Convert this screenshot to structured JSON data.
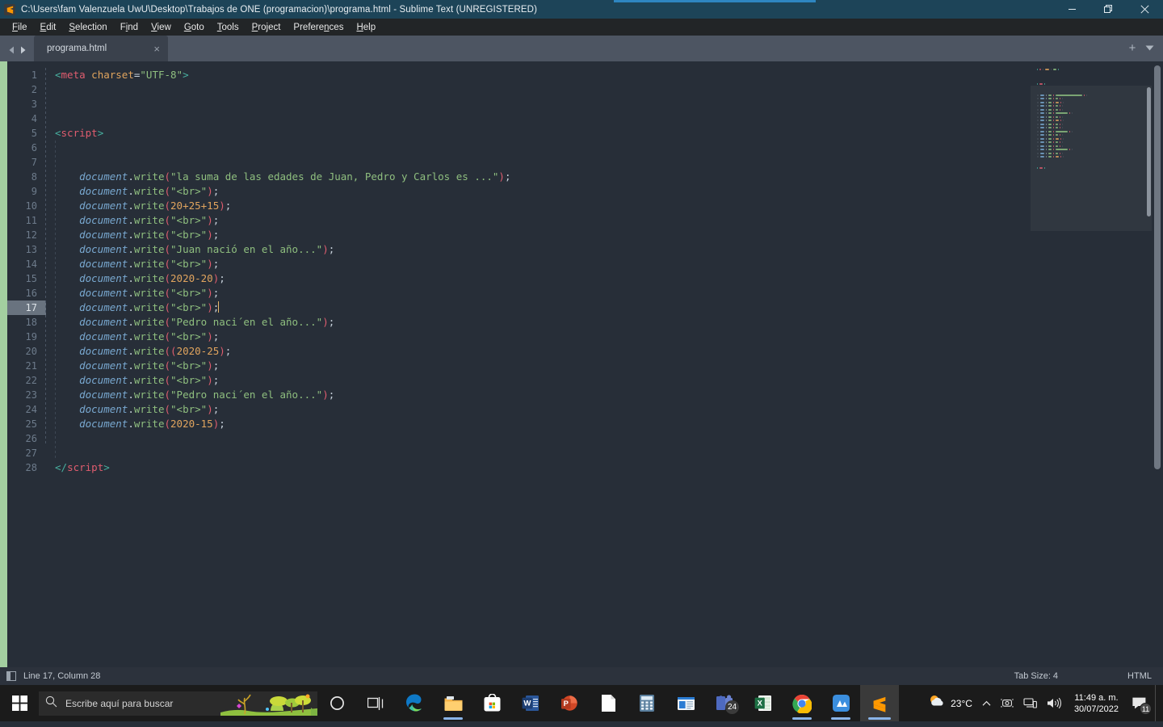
{
  "window": {
    "title": "C:\\Users\\fam Valenzuela UwU\\Desktop\\Trabajos de ONE (programacion)\\programa.html - Sublime Text (UNREGISTERED)",
    "app_icon": "sublime-text-icon",
    "controls": {
      "minimize": "minimize-icon",
      "maximize": "restore-icon",
      "close": "close-icon"
    }
  },
  "menubar": {
    "items": [
      {
        "label": "File",
        "mnemonic": "F"
      },
      {
        "label": "Edit",
        "mnemonic": "E"
      },
      {
        "label": "Selection",
        "mnemonic": "S"
      },
      {
        "label": "Find",
        "mnemonic": "i"
      },
      {
        "label": "View",
        "mnemonic": "V"
      },
      {
        "label": "Goto",
        "mnemonic": "G"
      },
      {
        "label": "Tools",
        "mnemonic": "T"
      },
      {
        "label": "Project",
        "mnemonic": "P"
      },
      {
        "label": "Preferences",
        "mnemonic": "n"
      },
      {
        "label": "Help",
        "mnemonic": "H"
      }
    ]
  },
  "tabbar": {
    "prev_icon": "arrow-left-icon",
    "next_icon": "arrow-right-icon",
    "tabs": [
      {
        "label": "programa.html",
        "close": "×",
        "active": true
      }
    ],
    "new_tab_label": "+",
    "menu_label": "▼"
  },
  "editor": {
    "first_line": 1,
    "total_lines": 28,
    "active_line": 17,
    "lines": [
      {
        "n": 1,
        "tokens": [
          {
            "t": "tagb",
            "v": "<"
          },
          {
            "t": "tag",
            "v": "meta"
          },
          {
            "t": "punc",
            "v": " "
          },
          {
            "t": "attr",
            "v": "charset"
          },
          {
            "t": "punc",
            "v": "="
          },
          {
            "t": "str",
            "v": "\"UTF-8\""
          },
          {
            "t": "tagb",
            "v": ">"
          }
        ]
      },
      {
        "n": 2,
        "tokens": []
      },
      {
        "n": 3,
        "tokens": []
      },
      {
        "n": 4,
        "tokens": []
      },
      {
        "n": 5,
        "tokens": [
          {
            "t": "tagb",
            "v": "<"
          },
          {
            "t": "tag",
            "v": "script"
          },
          {
            "t": "tagb",
            "v": ">"
          }
        ]
      },
      {
        "n": 6,
        "tokens": []
      },
      {
        "n": 7,
        "tokens": []
      },
      {
        "n": 8,
        "tokens": [
          {
            "t": "punc",
            "v": "    "
          },
          {
            "t": "obj",
            "v": "document"
          },
          {
            "t": "dot",
            "v": "."
          },
          {
            "t": "fn",
            "v": "write"
          },
          {
            "t": "paren",
            "v": "("
          },
          {
            "t": "str",
            "v": "\"la suma de las edades de Juan, Pedro y Carlos es ...\""
          },
          {
            "t": "paren",
            "v": ")"
          },
          {
            "t": "punc",
            "v": ";"
          }
        ]
      },
      {
        "n": 9,
        "tokens": [
          {
            "t": "punc",
            "v": "    "
          },
          {
            "t": "obj",
            "v": "document"
          },
          {
            "t": "dot",
            "v": "."
          },
          {
            "t": "fn",
            "v": "write"
          },
          {
            "t": "paren",
            "v": "("
          },
          {
            "t": "str",
            "v": "\"<br>\""
          },
          {
            "t": "paren",
            "v": ")"
          },
          {
            "t": "punc",
            "v": ";"
          }
        ]
      },
      {
        "n": 10,
        "tokens": [
          {
            "t": "punc",
            "v": "    "
          },
          {
            "t": "obj",
            "v": "document"
          },
          {
            "t": "dot",
            "v": "."
          },
          {
            "t": "fn",
            "v": "write"
          },
          {
            "t": "paren",
            "v": "("
          },
          {
            "t": "num",
            "v": "20+25+15"
          },
          {
            "t": "paren",
            "v": ")"
          },
          {
            "t": "punc",
            "v": ";"
          }
        ]
      },
      {
        "n": 11,
        "tokens": [
          {
            "t": "punc",
            "v": "    "
          },
          {
            "t": "obj",
            "v": "document"
          },
          {
            "t": "dot",
            "v": "."
          },
          {
            "t": "fn",
            "v": "write"
          },
          {
            "t": "paren",
            "v": "("
          },
          {
            "t": "str",
            "v": "\"<br>\""
          },
          {
            "t": "paren",
            "v": ")"
          },
          {
            "t": "punc",
            "v": ";"
          }
        ]
      },
      {
        "n": 12,
        "tokens": [
          {
            "t": "punc",
            "v": "    "
          },
          {
            "t": "obj",
            "v": "document"
          },
          {
            "t": "dot",
            "v": "."
          },
          {
            "t": "fn",
            "v": "write"
          },
          {
            "t": "paren",
            "v": "("
          },
          {
            "t": "str",
            "v": "\"<br>\""
          },
          {
            "t": "paren",
            "v": ")"
          },
          {
            "t": "punc",
            "v": ";"
          }
        ]
      },
      {
        "n": 13,
        "tokens": [
          {
            "t": "punc",
            "v": "    "
          },
          {
            "t": "obj",
            "v": "document"
          },
          {
            "t": "dot",
            "v": "."
          },
          {
            "t": "fn",
            "v": "write"
          },
          {
            "t": "paren",
            "v": "("
          },
          {
            "t": "str",
            "v": "\"Juan nació en el año...\""
          },
          {
            "t": "paren",
            "v": ")"
          },
          {
            "t": "punc",
            "v": ";"
          }
        ]
      },
      {
        "n": 14,
        "tokens": [
          {
            "t": "punc",
            "v": "    "
          },
          {
            "t": "obj",
            "v": "document"
          },
          {
            "t": "dot",
            "v": "."
          },
          {
            "t": "fn",
            "v": "write"
          },
          {
            "t": "paren",
            "v": "("
          },
          {
            "t": "str",
            "v": "\"<br>\""
          },
          {
            "t": "paren",
            "v": ")"
          },
          {
            "t": "punc",
            "v": ";"
          }
        ]
      },
      {
        "n": 15,
        "tokens": [
          {
            "t": "punc",
            "v": "    "
          },
          {
            "t": "obj",
            "v": "document"
          },
          {
            "t": "dot",
            "v": "."
          },
          {
            "t": "fn",
            "v": "write"
          },
          {
            "t": "paren",
            "v": "("
          },
          {
            "t": "num",
            "v": "2020-20"
          },
          {
            "t": "paren",
            "v": ")"
          },
          {
            "t": "punc",
            "v": ";"
          }
        ]
      },
      {
        "n": 16,
        "tokens": [
          {
            "t": "punc",
            "v": "    "
          },
          {
            "t": "obj",
            "v": "document"
          },
          {
            "t": "dot",
            "v": "."
          },
          {
            "t": "fn",
            "v": "write"
          },
          {
            "t": "paren",
            "v": "("
          },
          {
            "t": "str",
            "v": "\"<br>\""
          },
          {
            "t": "paren",
            "v": ")"
          },
          {
            "t": "punc",
            "v": ";"
          }
        ]
      },
      {
        "n": 17,
        "tokens": [
          {
            "t": "punc",
            "v": "    "
          },
          {
            "t": "obj",
            "v": "document"
          },
          {
            "t": "dot",
            "v": "."
          },
          {
            "t": "fn",
            "v": "write"
          },
          {
            "t": "paren",
            "v": "("
          },
          {
            "t": "str",
            "v": "\"<br>\""
          },
          {
            "t": "paren",
            "v": ")"
          },
          {
            "t": "punc",
            "v": ";"
          },
          {
            "t": "cursor",
            "v": ""
          }
        ]
      },
      {
        "n": 18,
        "tokens": [
          {
            "t": "punc",
            "v": "    "
          },
          {
            "t": "obj",
            "v": "document"
          },
          {
            "t": "dot",
            "v": "."
          },
          {
            "t": "fn",
            "v": "write"
          },
          {
            "t": "paren",
            "v": "("
          },
          {
            "t": "str",
            "v": "\"Pedro naci´en el año...\""
          },
          {
            "t": "paren",
            "v": ")"
          },
          {
            "t": "punc",
            "v": ";"
          }
        ]
      },
      {
        "n": 19,
        "tokens": [
          {
            "t": "punc",
            "v": "    "
          },
          {
            "t": "obj",
            "v": "document"
          },
          {
            "t": "dot",
            "v": "."
          },
          {
            "t": "fn",
            "v": "write"
          },
          {
            "t": "paren",
            "v": "("
          },
          {
            "t": "str",
            "v": "\"<br>\""
          },
          {
            "t": "paren",
            "v": ")"
          },
          {
            "t": "punc",
            "v": ";"
          }
        ]
      },
      {
        "n": 20,
        "tokens": [
          {
            "t": "punc",
            "v": "    "
          },
          {
            "t": "obj",
            "v": "document"
          },
          {
            "t": "dot",
            "v": "."
          },
          {
            "t": "fn",
            "v": "write"
          },
          {
            "t": "paren",
            "v": "(("
          },
          {
            "t": "num",
            "v": "2020-25"
          },
          {
            "t": "paren",
            "v": ")"
          },
          {
            "t": "punc",
            "v": ";"
          }
        ]
      },
      {
        "n": 21,
        "tokens": [
          {
            "t": "punc",
            "v": "    "
          },
          {
            "t": "obj",
            "v": "document"
          },
          {
            "t": "dot",
            "v": "."
          },
          {
            "t": "fn",
            "v": "write"
          },
          {
            "t": "paren",
            "v": "("
          },
          {
            "t": "str",
            "v": "\"<br>\""
          },
          {
            "t": "paren",
            "v": ")"
          },
          {
            "t": "punc",
            "v": ";"
          }
        ]
      },
      {
        "n": 22,
        "tokens": [
          {
            "t": "punc",
            "v": "    "
          },
          {
            "t": "obj",
            "v": "document"
          },
          {
            "t": "dot",
            "v": "."
          },
          {
            "t": "fn",
            "v": "write"
          },
          {
            "t": "paren",
            "v": "("
          },
          {
            "t": "str",
            "v": "\"<br>\""
          },
          {
            "t": "paren",
            "v": ")"
          },
          {
            "t": "punc",
            "v": ";"
          }
        ]
      },
      {
        "n": 23,
        "tokens": [
          {
            "t": "punc",
            "v": "    "
          },
          {
            "t": "obj",
            "v": "document"
          },
          {
            "t": "dot",
            "v": "."
          },
          {
            "t": "fn",
            "v": "write"
          },
          {
            "t": "paren",
            "v": "("
          },
          {
            "t": "str",
            "v": "\"Pedro naci´en el año...\""
          },
          {
            "t": "paren",
            "v": ")"
          },
          {
            "t": "punc",
            "v": ";"
          }
        ]
      },
      {
        "n": 24,
        "tokens": [
          {
            "t": "punc",
            "v": "    "
          },
          {
            "t": "obj",
            "v": "document"
          },
          {
            "t": "dot",
            "v": "."
          },
          {
            "t": "fn",
            "v": "write"
          },
          {
            "t": "paren",
            "v": "("
          },
          {
            "t": "str",
            "v": "\"<br>\""
          },
          {
            "t": "paren",
            "v": ")"
          },
          {
            "t": "punc",
            "v": ";"
          }
        ]
      },
      {
        "n": 25,
        "tokens": [
          {
            "t": "punc",
            "v": "    "
          },
          {
            "t": "obj",
            "v": "document"
          },
          {
            "t": "dot",
            "v": "."
          },
          {
            "t": "fn",
            "v": "write"
          },
          {
            "t": "paren",
            "v": "("
          },
          {
            "t": "num",
            "v": "2020-15"
          },
          {
            "t": "paren",
            "v": ")"
          },
          {
            "t": "punc",
            "v": ";"
          }
        ]
      },
      {
        "n": 26,
        "tokens": []
      },
      {
        "n": 27,
        "tokens": []
      },
      {
        "n": 28,
        "tokens": [
          {
            "t": "tagb",
            "v": "</"
          },
          {
            "t": "tag",
            "v": "script"
          },
          {
            "t": "tagb",
            "v": ">"
          }
        ]
      }
    ]
  },
  "statusbar": {
    "sidebar_icon": "sidebar-toggle-icon",
    "position": "Line 17, Column 28",
    "tab_size": "Tab Size: 4",
    "syntax": "HTML"
  },
  "taskbar": {
    "start_icon": "windows-start-icon",
    "search": {
      "icon": "search-icon",
      "placeholder": "Escribe aquí para buscar"
    },
    "buttons": [
      {
        "name": "cortana-icon",
        "label": ""
      },
      {
        "name": "task-view-icon",
        "label": ""
      },
      {
        "name": "microsoft-edge-icon",
        "label": "",
        "running": true
      },
      {
        "name": "file-explorer-icon",
        "label": "",
        "running": true
      },
      {
        "name": "microsoft-store-icon",
        "label": ""
      },
      {
        "name": "microsoft-word-icon",
        "label": ""
      },
      {
        "name": "microsoft-powerpoint-icon",
        "label": ""
      },
      {
        "name": "notepad-icon",
        "label": ""
      },
      {
        "name": "calculator-icon",
        "label": ""
      },
      {
        "name": "news-icon",
        "label": ""
      },
      {
        "name": "teams-icon",
        "label": "24"
      },
      {
        "name": "microsoft-excel-icon",
        "label": ""
      },
      {
        "name": "google-chrome-icon",
        "label": "",
        "running": true
      },
      {
        "name": "atlas-app-icon",
        "label": "",
        "running": true
      },
      {
        "name": "sublime-text-icon",
        "label": "",
        "running": true,
        "active": true
      }
    ],
    "tray": {
      "weather_icon": "weather-partly-cloudy-icon",
      "temperature": "23°C",
      "chevron_icon": "chevron-up-icon",
      "hidden_icons": [
        "camera-icon",
        "network-icon",
        "volume-icon"
      ],
      "time": "11:49 a. m.",
      "date": "30/07/2022",
      "notification_icon": "notification-icon",
      "notification_count": "11"
    }
  },
  "colors": {
    "titlebar": "#1d4458",
    "menubar": "#222527",
    "tabbar": "#4d5562",
    "editor_bg": "#272e38",
    "statusbar": "#2c323c",
    "taskbar": "#1b1b1b",
    "edge_marker": "#a3cfa0",
    "accent": "#e0a45e"
  }
}
